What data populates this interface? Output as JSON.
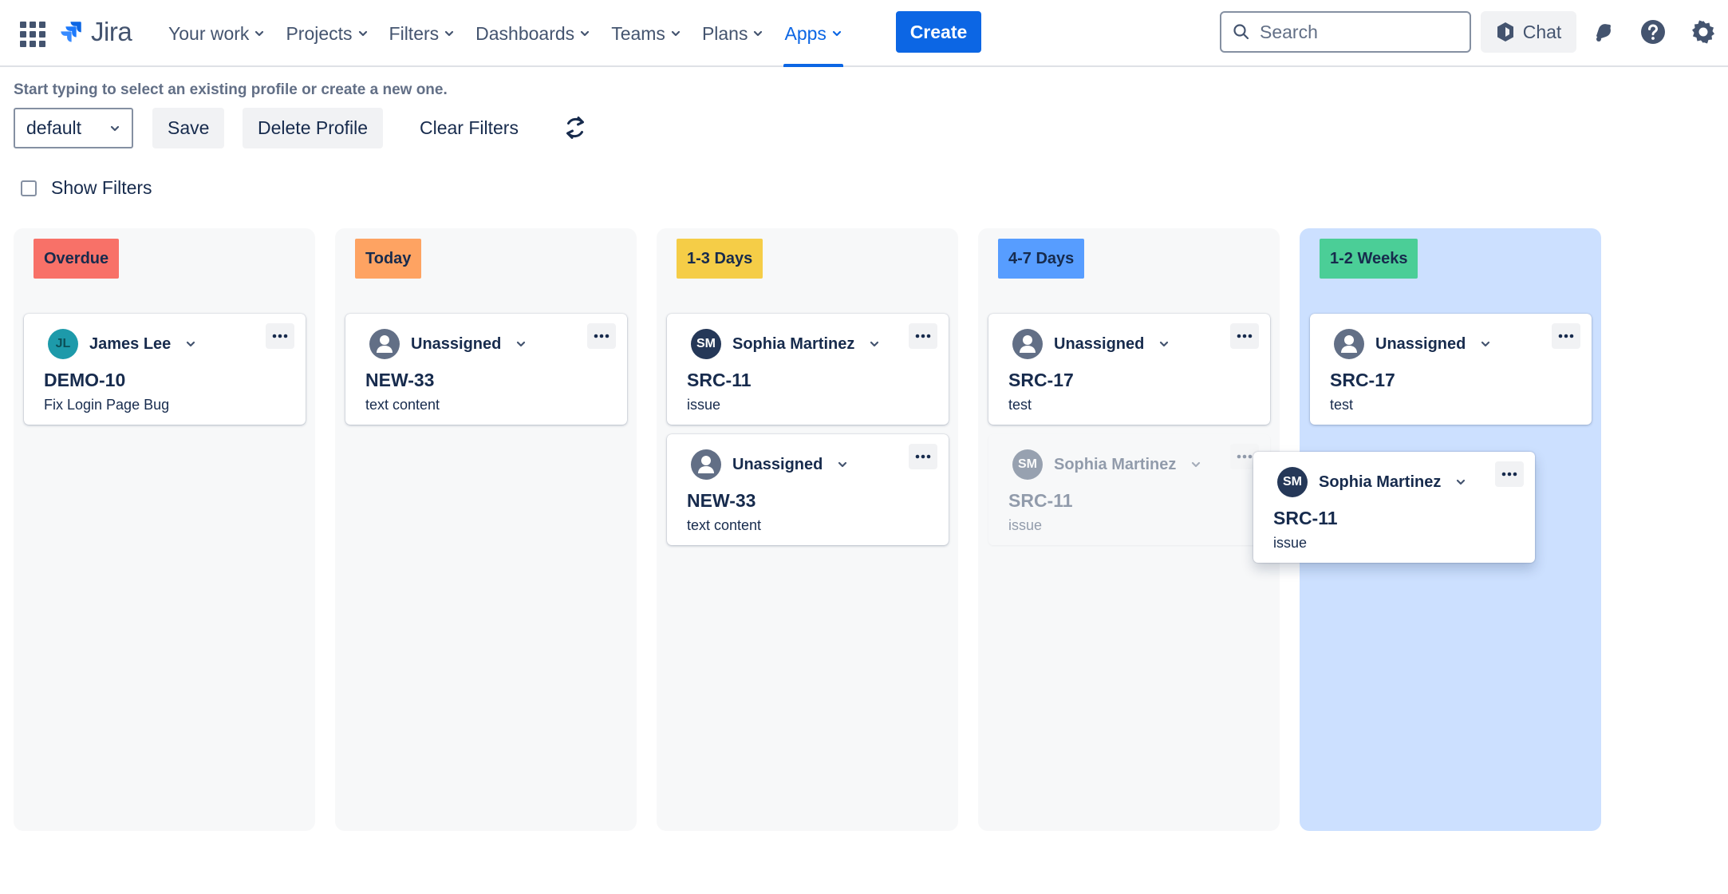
{
  "nav": {
    "logo_text": "Jira",
    "items": [
      {
        "label": "Your work"
      },
      {
        "label": "Projects"
      },
      {
        "label": "Filters"
      },
      {
        "label": "Dashboards"
      },
      {
        "label": "Teams"
      },
      {
        "label": "Plans"
      },
      {
        "label": "Apps",
        "active": true
      }
    ],
    "create_label": "Create",
    "search_placeholder": "Search",
    "chat_label": "Chat",
    "icons": [
      "app-switcher-icon",
      "jira-logo-icon",
      "search-icon",
      "chat-icon",
      "notifications-icon",
      "help-icon",
      "settings-icon"
    ],
    "accent_color": "#0c66e4"
  },
  "toolbar": {
    "hint": "Start typing to select an existing profile or create a new one.",
    "profile_value": "default",
    "save_label": "Save",
    "delete_label": "Delete Profile",
    "clear_label": "Clear Filters",
    "show_filters_label": "Show Filters",
    "show_filters_checked": false
  },
  "columns": [
    {
      "label": "Overdue",
      "color": "#f87168",
      "cards": [
        {
          "assignee": "James Lee",
          "initials": "JL",
          "key": "DEMO-10",
          "summary": "Fix Login Page Bug"
        }
      ]
    },
    {
      "label": "Today",
      "color": "#fea362",
      "cards": [
        {
          "assignee": "Unassigned",
          "key": "NEW-33",
          "summary": "text content"
        }
      ]
    },
    {
      "label": "1-3 Days",
      "color": "#f5cd47",
      "cards": [
        {
          "assignee": "Sophia Martinez",
          "initials": "SM",
          "key": "SRC-11",
          "summary": "issue"
        },
        {
          "assignee": "Unassigned",
          "key": "NEW-33",
          "summary": "text content"
        }
      ]
    },
    {
      "label": "4-7 Days",
      "color": "#579dff",
      "cards": [
        {
          "assignee": "Unassigned",
          "key": "SRC-17",
          "summary": "test"
        },
        {
          "assignee": "Sophia Martinez",
          "initials": "SM",
          "key": "SRC-11",
          "summary": "issue",
          "state": "drag-placeholder"
        }
      ]
    },
    {
      "label": "1-2 Weeks",
      "color": "#4bce97",
      "highlight": "#cce0ff",
      "cards": [
        {
          "assignee": "Unassigned",
          "key": "SRC-17",
          "summary": "test"
        }
      ]
    }
  ],
  "dragging_card": {
    "assignee": "Sophia Martinez",
    "initials": "SM",
    "key": "SRC-11",
    "summary": "issue"
  }
}
